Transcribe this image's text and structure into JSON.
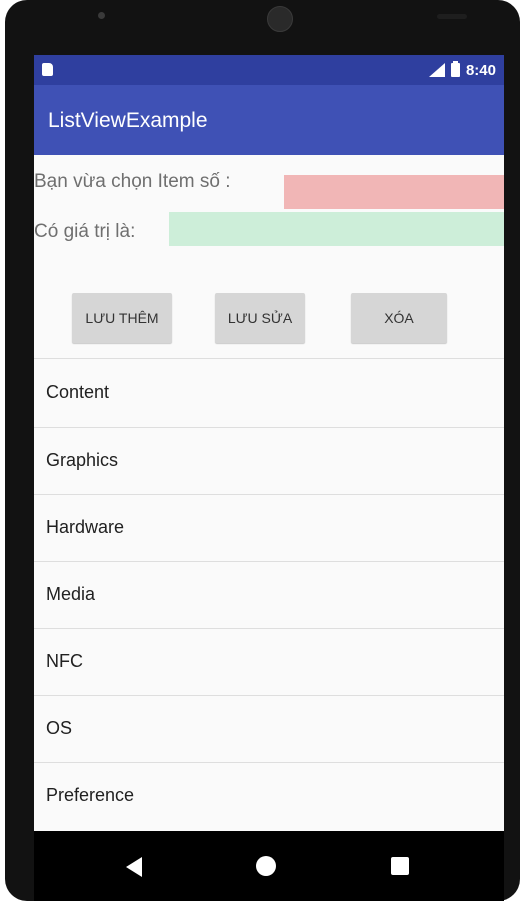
{
  "status_bar": {
    "time": "8:40",
    "icons": [
      "sd-card-icon",
      "signal-icon",
      "battery-icon"
    ]
  },
  "app_bar": {
    "title": "ListViewExample",
    "color": "#3f51b5",
    "status_color": "#2f3f9f"
  },
  "form": {
    "selected_item_label": "Bạn vừa chọn Item số :",
    "selected_item_value": "",
    "value_label": "Có giá trị là:",
    "value_value": ""
  },
  "buttons": {
    "add_label": "LƯU THÊM",
    "edit_label": "LƯU SỬA",
    "delete_label": "XÓA"
  },
  "list": {
    "items": [
      "Content",
      "Graphics",
      "Hardware",
      "Media",
      "NFC",
      "OS",
      "Preference"
    ]
  },
  "nav_bar": {
    "icons": [
      "back-icon",
      "home-icon",
      "recents-icon"
    ]
  }
}
